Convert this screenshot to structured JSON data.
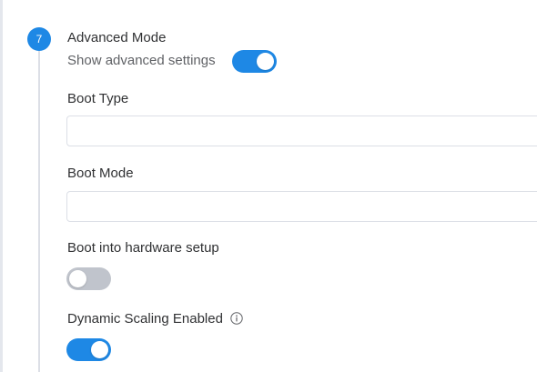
{
  "step": {
    "number": "7",
    "title": "Advanced Mode"
  },
  "advanced": {
    "label": "Show advanced settings",
    "enabled": true
  },
  "boot_type": {
    "label": "Boot Type",
    "value": "",
    "placeholder": ""
  },
  "boot_mode": {
    "label": "Boot Mode",
    "value": "",
    "placeholder": ""
  },
  "hardware_setup": {
    "label": "Boot into hardware setup",
    "enabled": false
  },
  "dynamic_scaling": {
    "label": "Dynamic Scaling Enabled",
    "enabled": true,
    "info_icon": "info-circle-icon"
  },
  "colors": {
    "accent": "#1e88e5",
    "switch_off": "#c0c4cc"
  }
}
